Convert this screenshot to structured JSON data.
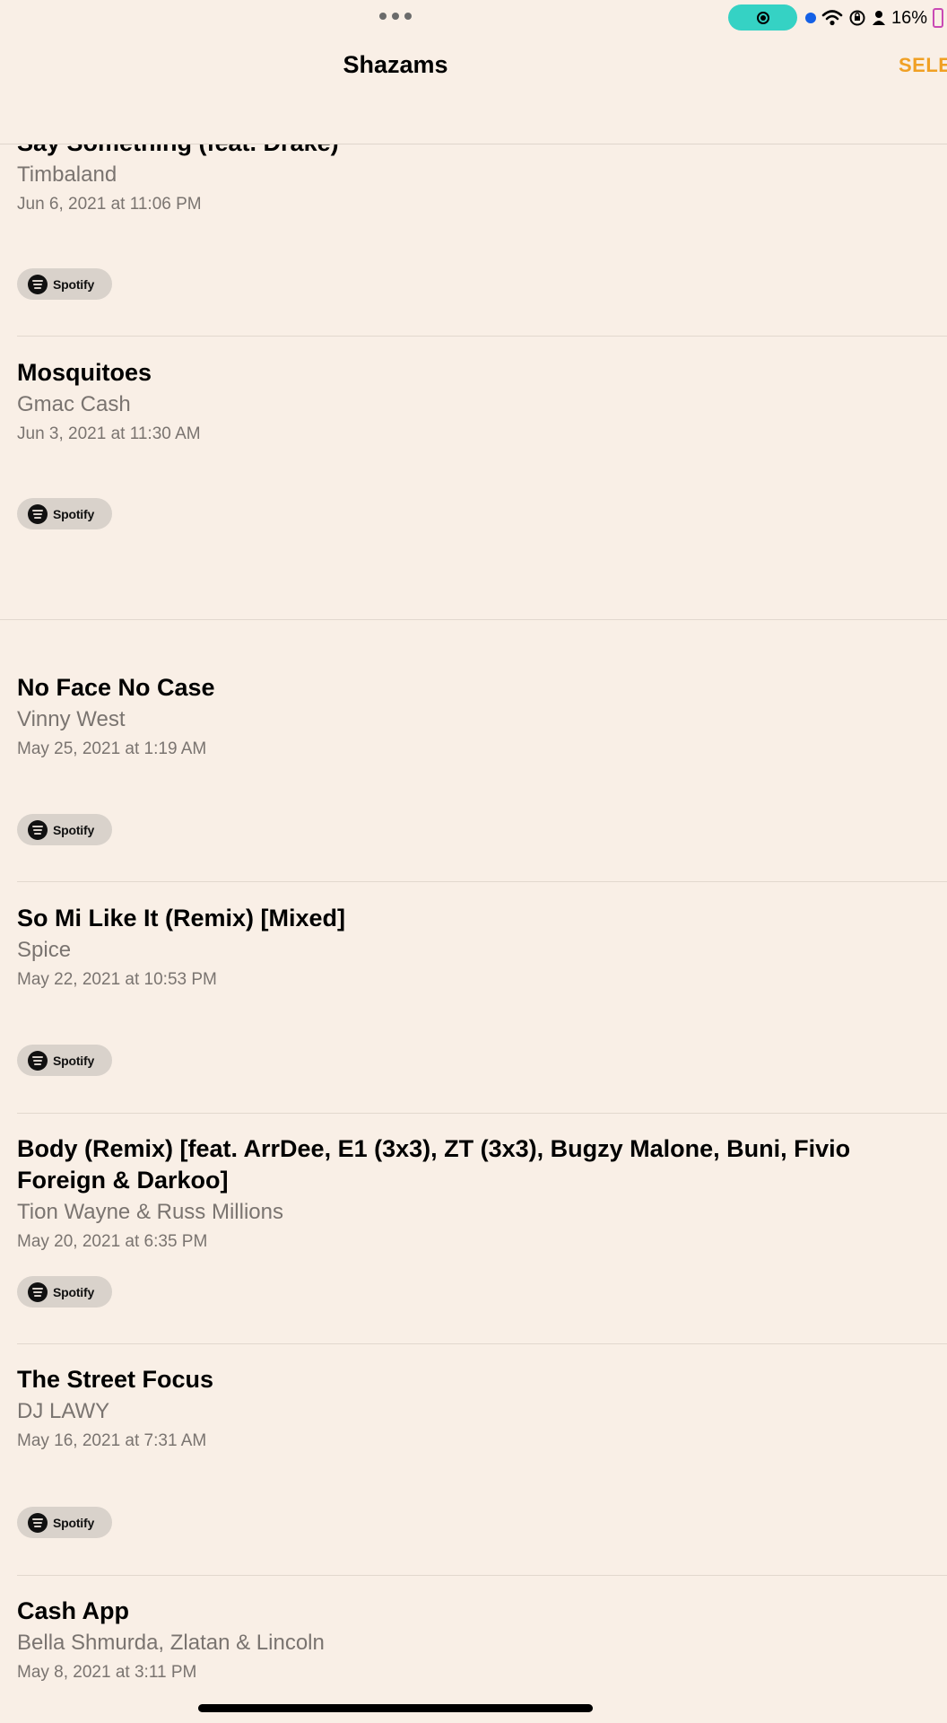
{
  "status_bar": {
    "battery_percent": "16%",
    "icons": [
      "more-dots-icon",
      "screen-record-icon",
      "location-dot-icon",
      "wifi-icon",
      "orientation-lock-icon",
      "person-icon",
      "battery-icon"
    ],
    "record_color": "#35D2C4",
    "battery_color": "#C94AB4"
  },
  "nav": {
    "title": "Shazams",
    "select_label": "SELE",
    "accent_color": "#F0A024"
  },
  "shazams": [
    {
      "title": "Say Something (feat. Drake)",
      "artist": "Timbaland",
      "date": "Jun 6, 2021 at 11:06 PM",
      "button": "Spotify"
    },
    {
      "title": "Mosquitoes",
      "artist": "Gmac Cash",
      "date": "Jun 3, 2021 at 11:30 AM",
      "button": "Spotify"
    },
    {
      "title": "No Face No Case",
      "artist": "Vinny West",
      "date": "May 25, 2021 at 1:19 AM",
      "button": "Spotify"
    },
    {
      "title": "So Mi Like It (Remix) [Mixed]",
      "artist": "Spice",
      "date": "May 22, 2021 at 10:53 PM",
      "button": "Spotify"
    },
    {
      "title": "Body (Remix) [feat. ArrDee, E1 (3x3), ZT (3x3), Bugzy Malone, Buni, Fivio Foreign & Darkoo]",
      "artist": "Tion Wayne & Russ Millions",
      "date": "May 20, 2021 at 6:35 PM",
      "button": "Spotify"
    },
    {
      "title": "The Street Focus",
      "artist": "DJ LAWY",
      "date": "May 16, 2021 at 7:31 AM",
      "button": "Spotify"
    },
    {
      "title": "Cash App",
      "artist": "Bella Shmurda, Zlatan & Lincoln",
      "date": "May 8, 2021 at 3:11 PM",
      "button": "Spotify"
    }
  ]
}
